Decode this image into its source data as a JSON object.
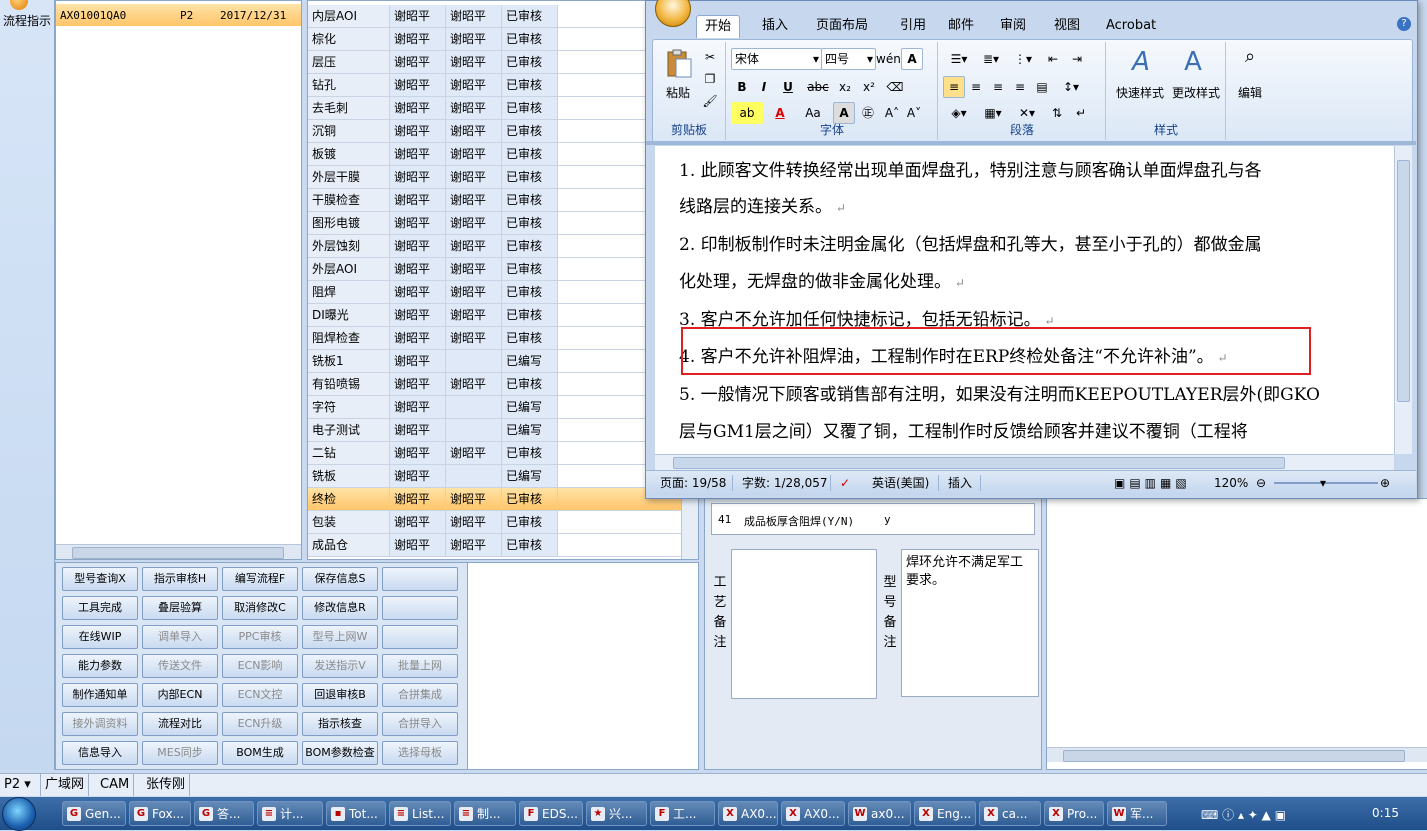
{
  "left_sidebar": {
    "label": "流程指示"
  },
  "order_list": {
    "id": "AX01001QA0",
    "layer": "P2",
    "date": "2017/12/31"
  },
  "process_table": {
    "rows": [
      {
        "process": "内层AOI",
        "maker": "谢昭平",
        "checker": "谢昭平",
        "status": "已审核"
      },
      {
        "process": "棕化",
        "maker": "谢昭平",
        "checker": "谢昭平",
        "status": "已审核"
      },
      {
        "process": "层压",
        "maker": "谢昭平",
        "checker": "谢昭平",
        "status": "已审核"
      },
      {
        "process": "钻孔",
        "maker": "谢昭平",
        "checker": "谢昭平",
        "status": "已审核"
      },
      {
        "process": "去毛刺",
        "maker": "谢昭平",
        "checker": "谢昭平",
        "status": "已审核"
      },
      {
        "process": "沉铜",
        "maker": "谢昭平",
        "checker": "谢昭平",
        "status": "已审核"
      },
      {
        "process": "板镀",
        "maker": "谢昭平",
        "checker": "谢昭平",
        "status": "已审核"
      },
      {
        "process": "外层干膜",
        "maker": "谢昭平",
        "checker": "谢昭平",
        "status": "已审核"
      },
      {
        "process": "干膜检查",
        "maker": "谢昭平",
        "checker": "谢昭平",
        "status": "已审核"
      },
      {
        "process": "图形电镀",
        "maker": "谢昭平",
        "checker": "谢昭平",
        "status": "已审核"
      },
      {
        "process": "外层蚀刻",
        "maker": "谢昭平",
        "checker": "谢昭平",
        "status": "已审核"
      },
      {
        "process": "外层AOI",
        "maker": "谢昭平",
        "checker": "谢昭平",
        "status": "已审核"
      },
      {
        "process": "阻焊",
        "maker": "谢昭平",
        "checker": "谢昭平",
        "status": "已审核"
      },
      {
        "process": "DI曝光",
        "maker": "谢昭平",
        "checker": "谢昭平",
        "status": "已审核"
      },
      {
        "process": "阻焊检查",
        "maker": "谢昭平",
        "checker": "谢昭平",
        "status": "已审核"
      },
      {
        "process": "铣板1",
        "maker": "谢昭平",
        "checker": "",
        "status": "已编写"
      },
      {
        "process": "有铅喷锡",
        "maker": "谢昭平",
        "checker": "谢昭平",
        "status": "已审核"
      },
      {
        "process": "字符",
        "maker": "谢昭平",
        "checker": "",
        "status": "已编写"
      },
      {
        "process": "电子测试",
        "maker": "谢昭平",
        "checker": "",
        "status": "已编写"
      },
      {
        "process": "二钻",
        "maker": "谢昭平",
        "checker": "谢昭平",
        "status": "已审核"
      },
      {
        "process": "铣板",
        "maker": "谢昭平",
        "checker": "",
        "status": "已编写"
      },
      {
        "process": "终检",
        "maker": "谢昭平",
        "checker": "谢昭平",
        "status": "已审核"
      },
      {
        "process": "包装",
        "maker": "谢昭平",
        "checker": "谢昭平",
        "status": "已审核"
      },
      {
        "process": "成品仓",
        "maker": "谢昭平",
        "checker": "谢昭平",
        "status": "已审核"
      }
    ]
  },
  "buttons": [
    [
      "型号查询X",
      "指示审核H",
      "编写流程F",
      "保存信息S",
      ""
    ],
    [
      "工具完成",
      "叠层验算",
      "取消修改C",
      "修改信息R",
      ""
    ],
    [
      "在线WIP",
      "调单导入",
      "PPC审核",
      "型号上网W",
      ""
    ],
    [
      "能力参数",
      "传送文件",
      "ECN影响",
      "发送指示V",
      "批量上网"
    ],
    [
      "制作通知单",
      "内部ECN",
      "ECN文控",
      "回退审核B",
      "合拼集成"
    ],
    [
      "接外调资料",
      "流程对比",
      "ECN升级",
      "指示核查",
      "合拼导入"
    ],
    [
      "信息导入",
      "MES同步",
      "BOM生成",
      "BOM参数检查",
      "选择母板"
    ]
  ],
  "notes": {
    "item_no": "41",
    "item_label": "成品板厚含阻焊(Y/N)",
    "item_value": "y",
    "process_note_label": "工艺备注",
    "model_note_label": "型号备注",
    "model_note_text": "焊环允许不满足军工要求。"
  },
  "app_status": {
    "layer": "P2",
    "network": "广域网",
    "module": "CAM",
    "user": "张传刚"
  },
  "word": {
    "tabs": [
      "开始",
      "插入",
      "页面布局",
      "引用",
      "邮件",
      "审阅",
      "视图",
      "Acrobat"
    ],
    "clipboard": {
      "paste": "粘贴",
      "group": "剪贴板"
    },
    "font": {
      "name": "宋体",
      "size": "四号",
      "group": "字体"
    },
    "paragraph": {
      "group": "段落"
    },
    "styles": {
      "quick": "快速样式",
      "change": "更改样式",
      "group": "样式"
    },
    "edit": {
      "label": "编辑"
    },
    "doc_lines": [
      "1. 此顾客文件转换经常出现单面焊盘孔，特别注意与顾客确认单面焊盘孔与各",
      "线路层的连接关系。",
      "2. 印制板制作时未注明金属化（包括焊盘和孔等大，甚至小于孔的）都做金属",
      "化处理，无焊盘的做非金属化处理。",
      "3. 客户不允许加任何快捷标记，包括无铅标记。",
      "4. 客户不允许补阻焊油，工程制作时在ERP终检处备注“不允许补油”。",
      "5. 一般情况下顾客或销售部有注明，如果没有注明而KEEPOUTLAYER层外(即GKO",
      "层与GM1层之间）又覆了铜，工程制作时反馈给顾客并建议不覆铜（工程将"
    ],
    "status": {
      "page": "页面: 19/58",
      "words": "字数: 1/28,057",
      "lang": "英语(美国)",
      "mode": "插入",
      "zoom": "120%"
    }
  },
  "taskbar": {
    "items": [
      "Gen...",
      "Fox...",
      "答...",
      "计...",
      "Tot...",
      "List...",
      "制...",
      "EDS...",
      "兴...",
      "工...",
      "AX0...",
      "AX0...",
      "ax0...",
      "Eng...",
      "ca...",
      "Pro...",
      "军..."
    ],
    "clock": "0:15"
  }
}
